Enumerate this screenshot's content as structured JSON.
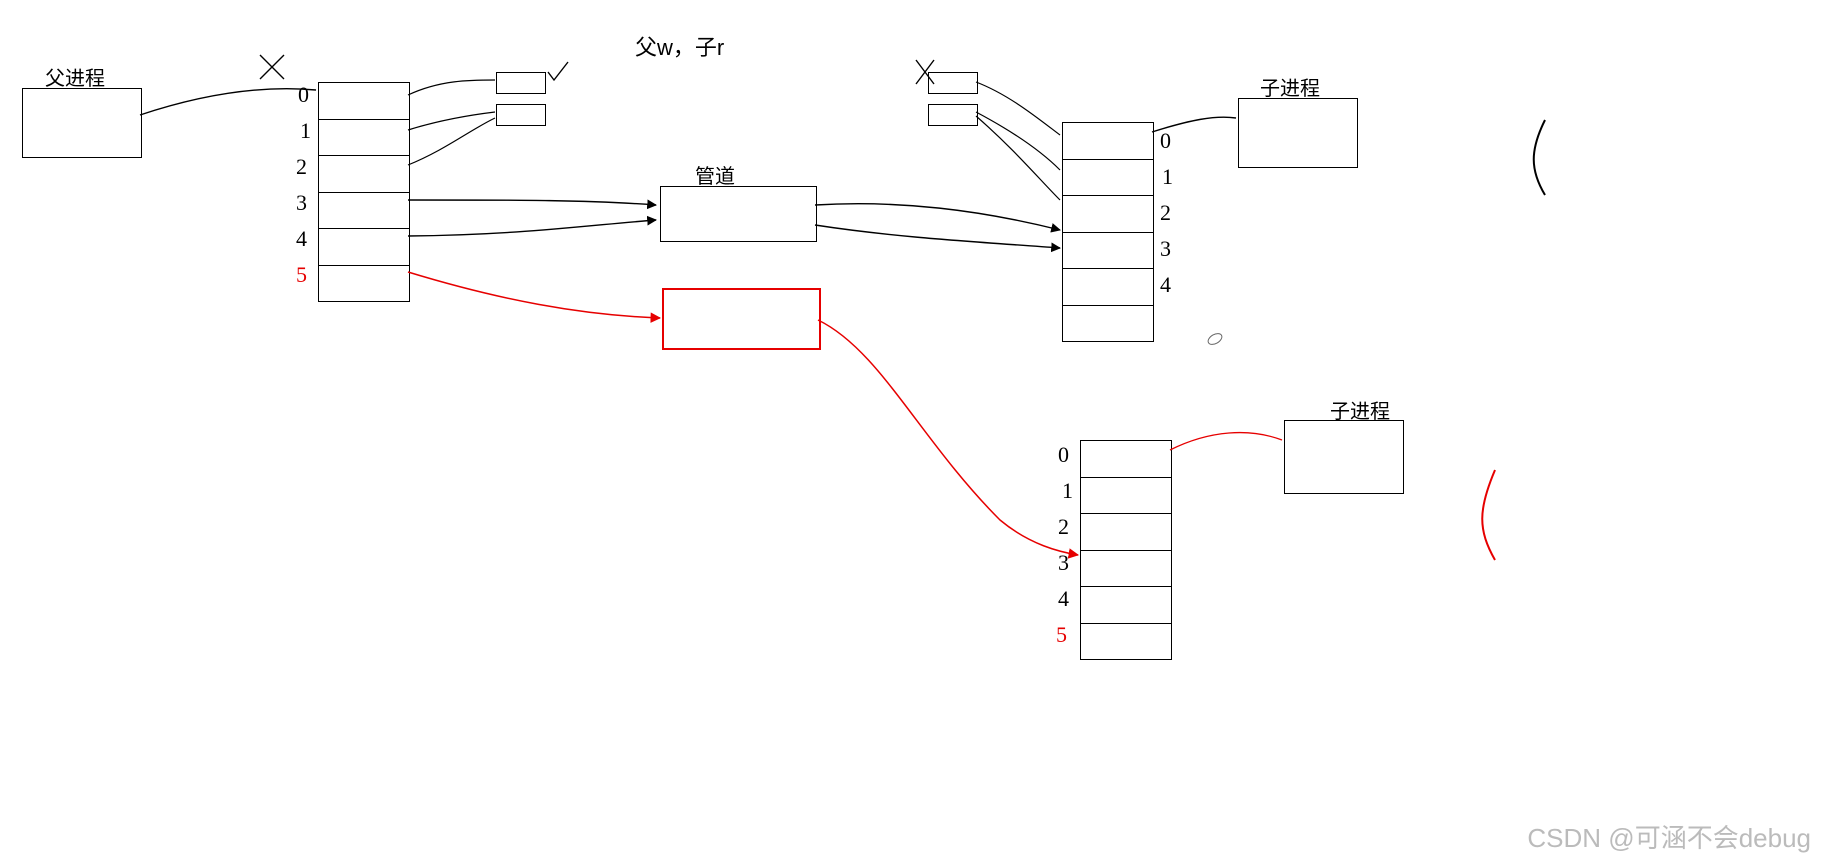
{
  "title_top": "父w，子r",
  "labels": {
    "parent": "父进程",
    "pipe": "管道",
    "child1": "子进程",
    "child2": "子进程"
  },
  "fd_indices": {
    "left": [
      "0",
      "1",
      "2",
      "3",
      "4",
      "5"
    ],
    "right1": [
      "0",
      "1",
      "2",
      "3",
      "4"
    ],
    "right2": [
      "0",
      "1",
      "2",
      "3",
      "4",
      "5"
    ]
  },
  "watermark": "CSDN @可涵不会debug"
}
